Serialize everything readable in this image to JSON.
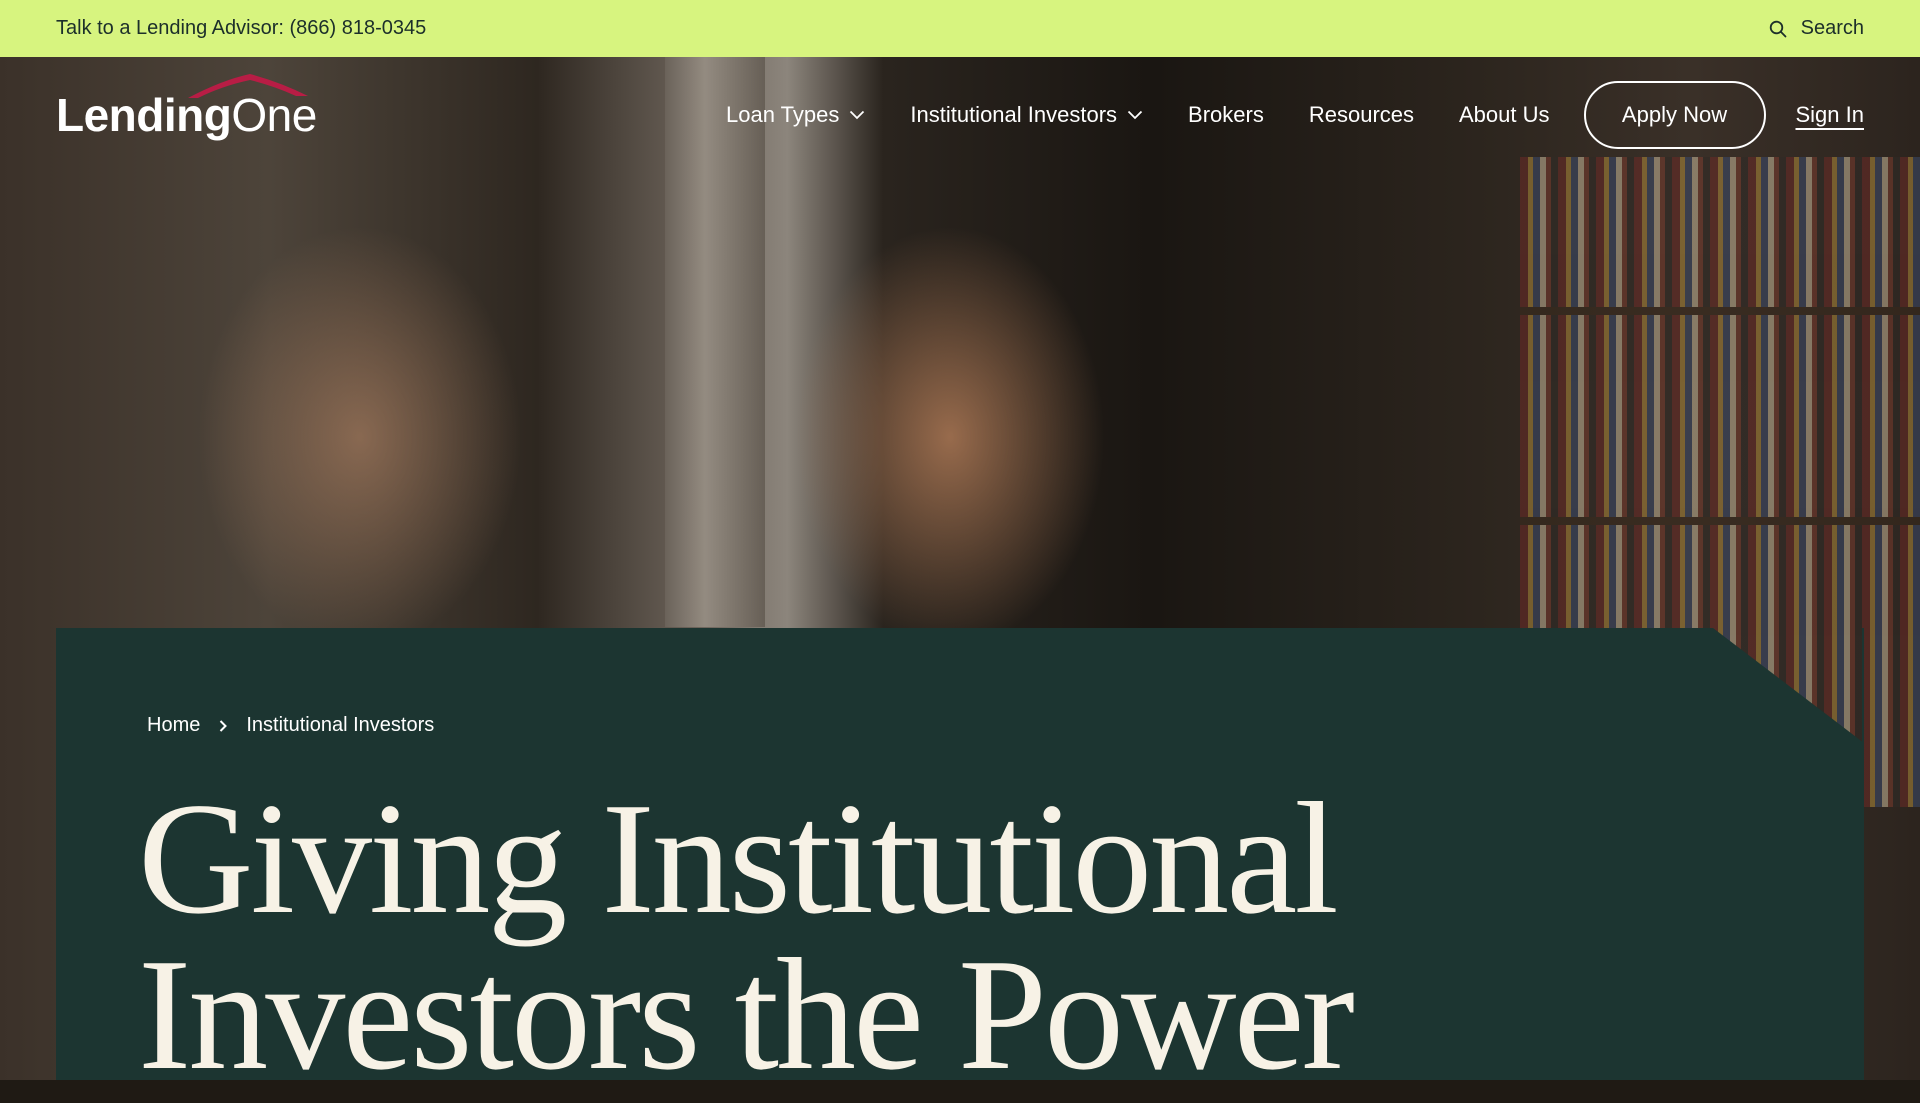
{
  "topbar": {
    "advisor_text": "Talk to a Lending Advisor: (866) 818-0345",
    "search_label": "Search",
    "search_icon": "search-icon"
  },
  "logo": {
    "part1": "Lending",
    "part2": "One",
    "roof_color": "#b81d45"
  },
  "nav": {
    "items": [
      {
        "label": "Loan Types",
        "has_dropdown": true
      },
      {
        "label": "Institutional Investors",
        "has_dropdown": true
      },
      {
        "label": "Brokers",
        "has_dropdown": false
      },
      {
        "label": "Resources",
        "has_dropdown": false
      },
      {
        "label": "About Us",
        "has_dropdown": false
      }
    ],
    "apply_label": "Apply Now",
    "signin_label": "Sign In"
  },
  "breadcrumb": {
    "home": "Home",
    "current": "Institutional Investors"
  },
  "hero": {
    "headline_line1": "Giving Institutional",
    "headline_line2": "Investors the Power"
  },
  "colors": {
    "topbar_bg": "#d7f47f",
    "panel_bg": "#1c3531",
    "headline": "#f7f2e6",
    "accent": "#b81d45"
  }
}
